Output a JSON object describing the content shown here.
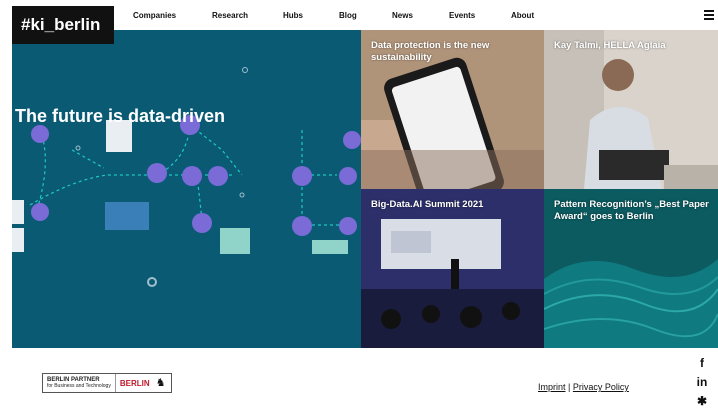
{
  "logo": "#ki_berlin",
  "nav": [
    "Companies",
    "Research",
    "Hubs",
    "Blog",
    "News",
    "Events",
    "About"
  ],
  "hero": {
    "title": "The future is data-driven"
  },
  "tiles": [
    {
      "title": "Data protection is the new sustainability"
    },
    {
      "title": "Kay Talmi, HELLA Aglaia"
    },
    {
      "title": "Big-Data.AI Summit 2021"
    },
    {
      "title": "Pattern Recognition’s „Best Paper Award“ goes to Berlin"
    }
  ],
  "footer": {
    "partner_line1": "BERLIN PARTNER",
    "partner_line2": "for Business and Technology",
    "berlin": "BERLIN",
    "imprint": "Imprint",
    "separator": "|",
    "privacy": "Privacy Policy"
  },
  "icons": {
    "menu": "menu-icon",
    "social": [
      "facebook-icon",
      "linkedin-icon",
      "twitter-icon"
    ]
  },
  "colors": {
    "hero_bg": "#0b5a74",
    "accent_teal": "#1ec8c8",
    "node_purple": "#7a6bd6",
    "brand_red": "#c0182a"
  }
}
